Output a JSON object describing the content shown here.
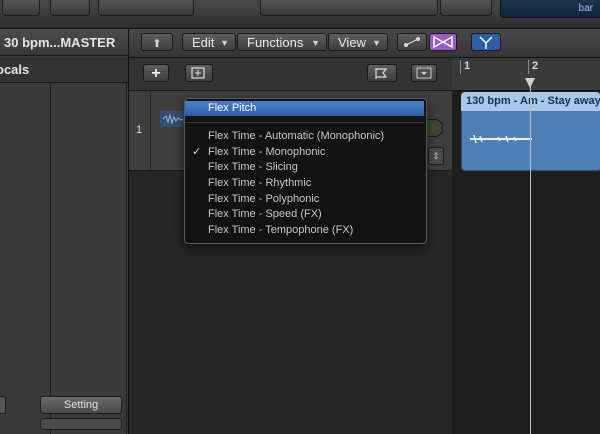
{
  "window": {
    "project_title": "30 bpm...MASTER",
    "lcd_label": "bar"
  },
  "inspector": {
    "strip_label": "ocals",
    "setting_label": "Setting"
  },
  "toolbar": {
    "menus": [
      "Edit",
      "Functions",
      "View"
    ]
  },
  "track": {
    "number": "1"
  },
  "ruler": {
    "bars": [
      "1",
      "2"
    ]
  },
  "region": {
    "name": "130 bpm - Am - Stay away"
  },
  "flex_menu": {
    "selected": "Flex Pitch",
    "checked": "Flex Time - Monophonic",
    "items": [
      "Flex Time - Automatic (Monophonic)",
      "Flex Time - Monophonic",
      "Flex Time - Slicing",
      "Flex Time - Rhythmic",
      "Flex Time - Polyphonic",
      "Flex Time - Speed (FX)",
      "Flex Time - Tempophone (FX)"
    ]
  },
  "colors": {
    "accent_blue": "#2d5fa8",
    "region_blue": "#4f7fb6",
    "flex_purple": "#9b59d0"
  }
}
